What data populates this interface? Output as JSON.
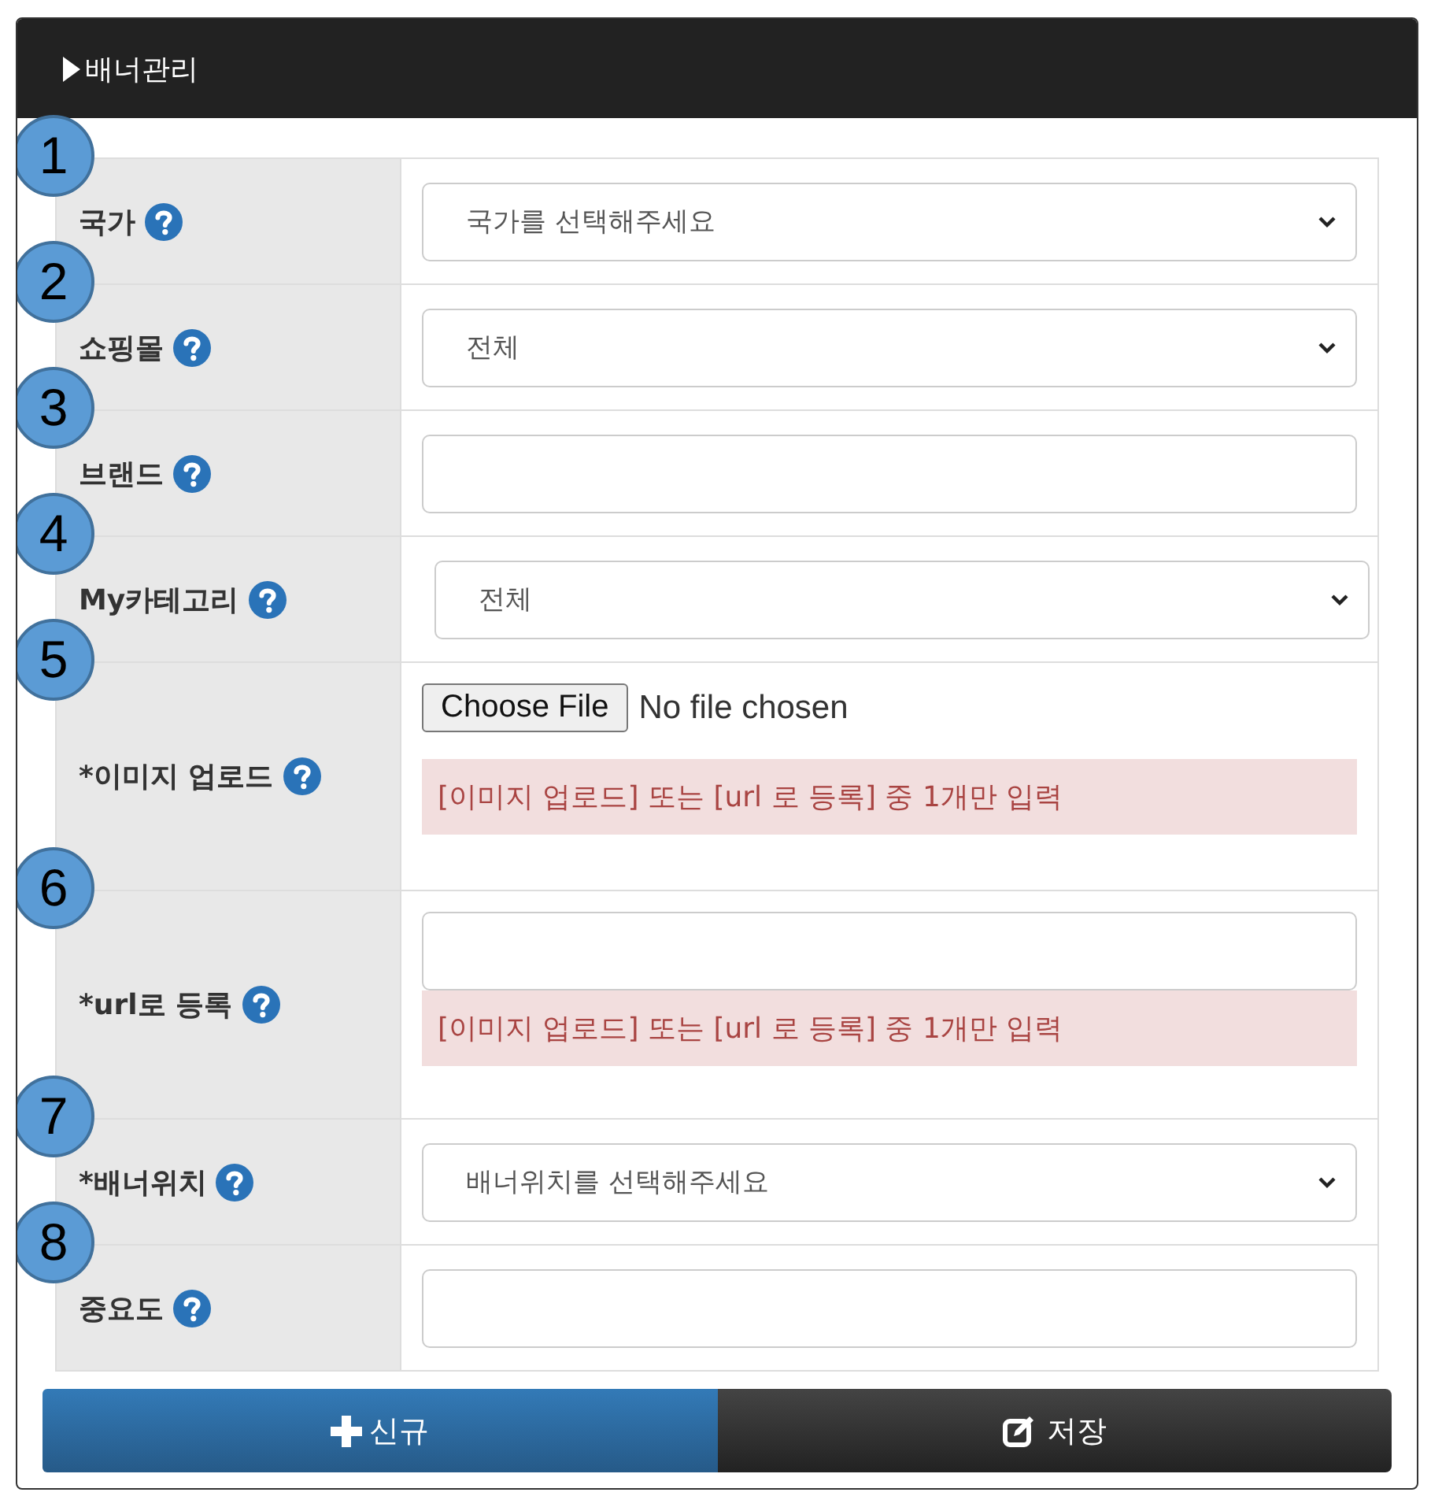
{
  "panel": {
    "title": "배너관리"
  },
  "fields": [
    {
      "marker": "1",
      "label": "국가",
      "kind": "select",
      "value": "국가를 선택해주세요"
    },
    {
      "marker": "2",
      "label": "쇼핑몰",
      "kind": "select",
      "value": "전체"
    },
    {
      "marker": "3",
      "label": "브랜드",
      "kind": "text"
    },
    {
      "marker": "4",
      "label": "My카테고리",
      "kind": "select",
      "value": "전체"
    },
    {
      "marker": "5",
      "label": "*이미지 업로드",
      "kind": "file",
      "button": "Choose File",
      "value": "No file chosen",
      "notice": "[이미지 업로드] 또는 [url 로 등록] 중 1개만 입력"
    },
    {
      "marker": "6",
      "label": "*url로 등록",
      "kind": "text",
      "notice": "[이미지 업로드] 또는 [url 로 등록] 중 1개만 입력"
    },
    {
      "marker": "7",
      "label": "*배너위치",
      "kind": "select",
      "value": "배너위치를 선택해주세요"
    },
    {
      "marker": "8",
      "label": "중요도",
      "kind": "text"
    }
  ],
  "buttons": [
    {
      "label": "신규",
      "kind": "new"
    },
    {
      "label": "저장",
      "kind": "save"
    }
  ]
}
